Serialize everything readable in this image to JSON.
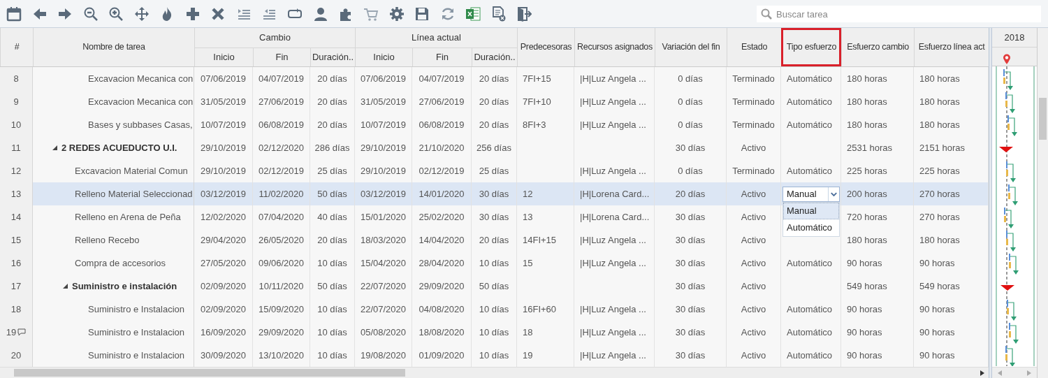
{
  "toolbar": {
    "search": {
      "placeholder": "Buscar tarea"
    }
  },
  "columns": [
    {
      "label": "#",
      "highlighted": false
    },
    {
      "label": "Nombre de tarea",
      "highlighted": false
    },
    {
      "label": "Cambio",
      "highlighted": false,
      "children": [
        {
          "label": "Inicio"
        },
        {
          "label": "Fin"
        },
        {
          "label": "Duración.."
        }
      ]
    },
    {
      "label": "Línea actual",
      "highlighted": false,
      "children": [
        {
          "label": "Inicio"
        },
        {
          "label": "Fin"
        },
        {
          "label": "Duración.."
        }
      ]
    },
    {
      "label": "Predecesoras",
      "highlighted": false
    },
    {
      "label": "Recursos asignados",
      "highlighted": false
    },
    {
      "label": "Variación del fin",
      "highlighted": false
    },
    {
      "label": "Estado",
      "highlighted": false
    },
    {
      "label": "Tipo esfuerzo",
      "highlighted": true
    },
    {
      "label": "Esfuerzo cambio",
      "highlighted": false
    },
    {
      "label": "Esfuerzo línea act",
      "highlighted": false
    }
  ],
  "gantt": {
    "year": "2018"
  },
  "rows": [
    {
      "number": "8",
      "name": "Excavacion Mecanica con",
      "selected": false,
      "has_comment": false,
      "cells": {
        "start_change": "07/06/2019",
        "end_change": "04/07/2019",
        "duration_change": "20 días",
        "start_baseline": "07/06/2019",
        "end_baseline": "04/07/2019",
        "duration_baseline": "20 días",
        "predecessors": "7FI+15",
        "resources": "|H|Luz Angela ...",
        "finish_variance": "0 días",
        "status": "Terminado",
        "effort_type": "Automático",
        "effort_change": "180 horas",
        "effort_baseline": "180 horas"
      }
    },
    {
      "number": "9",
      "name": "Excavacion Mecanica con",
      "selected": false,
      "has_comment": false,
      "cells": {
        "start_change": "31/05/2019",
        "end_change": "27/06/2019",
        "duration_change": "20 días",
        "start_baseline": "31/05/2019",
        "end_baseline": "27/06/2019",
        "duration_baseline": "20 días",
        "predecessors": "7FI+10",
        "resources": "|H|Luz Angela ...",
        "finish_variance": "0 días",
        "status": "Terminado",
        "effort_type": "Automático",
        "effort_change": "180 horas",
        "effort_baseline": "180 horas"
      }
    },
    {
      "number": "10",
      "name": "Bases y subbases Casas,",
      "selected": false,
      "has_comment": false,
      "cells": {
        "start_change": "10/07/2019",
        "end_change": "06/08/2019",
        "duration_change": "20 días",
        "start_baseline": "10/07/2019",
        "end_baseline": "06/08/2019",
        "duration_baseline": "20 días",
        "predecessors": "8FI+3",
        "resources": "|H|Luz Angela ...",
        "finish_variance": "0 días",
        "status": "Terminado",
        "effort_type": "Automático",
        "effort_change": "180 horas",
        "effort_baseline": "180 horas"
      }
    },
    {
      "number": "11",
      "name": "2 REDES ACUEDUCTO U.I.",
      "selected": false,
      "has_comment": false,
      "expanded": true,
      "cells": {
        "start_change": "29/10/2019",
        "end_change": "02/12/2020",
        "duration_change": "286 días",
        "start_baseline": "29/10/2019",
        "end_baseline": "21/10/2020",
        "duration_baseline": "256 días",
        "finish_variance": "30 días",
        "status": "Activo",
        "effort_change": "2531 horas",
        "effort_baseline": "2151 horas"
      },
      "children": [
        {
          "number": "12",
          "name": "Excavacion Material Comun",
          "selected": false,
          "has_comment": false,
          "cells": {
            "start_change": "29/10/2019",
            "end_change": "02/12/2019",
            "duration_change": "25 días",
            "start_baseline": "29/10/2019",
            "end_baseline": "02/12/2019",
            "duration_baseline": "25 días",
            "resources": "|H|Luz Angela ...",
            "finish_variance": "0 días",
            "status": "Terminado",
            "effort_type": "Automático",
            "effort_change": "225 horas",
            "effort_baseline": "225 horas"
          }
        },
        {
          "number": "13",
          "name": "Relleno Material Seleccionad",
          "selected": true,
          "has_comment": false,
          "cells": {
            "start_change": "03/12/2019",
            "end_change": "11/02/2020",
            "duration_change": "50 días",
            "start_baseline": "03/12/2019",
            "end_baseline": "14/01/2020",
            "duration_baseline": "30 días",
            "predecessors": "12",
            "resources": "|H|Lorena Card...",
            "finish_variance": "20 días",
            "status": "Activo",
            "effort_change": "200 horas",
            "effort_baseline": "270 horas"
          },
          "effort_type_editor": {
            "value": "Manual",
            "options": [
              {
                "label": "Manual",
                "selected": true
              },
              {
                "label": "Automático",
                "selected": false
              }
            ]
          }
        },
        {
          "number": "14",
          "name": "Relleno en Arena de Peña",
          "selected": false,
          "has_comment": false,
          "cells": {
            "start_change": "12/02/2020",
            "end_change": "07/04/2020",
            "duration_change": "40 días",
            "start_baseline": "15/01/2020",
            "end_baseline": "25/02/2020",
            "duration_baseline": "30 días",
            "predecessors": "13",
            "resources": "|H|Lorena Card...",
            "finish_variance": "30 días",
            "status": "Activo",
            "effort_change": "720 horas",
            "effort_baseline": "270 horas"
          }
        },
        {
          "number": "15",
          "name": "Relleno Recebo",
          "selected": false,
          "has_comment": false,
          "cells": {
            "start_change": "29/04/2020",
            "end_change": "26/05/2020",
            "duration_change": "20 días",
            "start_baseline": "18/03/2020",
            "end_baseline": "14/04/2020",
            "duration_baseline": "20 días",
            "predecessors": "14FI+15",
            "resources": "|H|Luz Angela ...",
            "finish_variance": "30 días",
            "status": "Activo",
            "effort_change": "180 horas",
            "effort_baseline": "180 horas"
          }
        },
        {
          "number": "16",
          "name": "Compra de accesorios",
          "selected": false,
          "has_comment": false,
          "cells": {
            "start_change": "27/05/2020",
            "end_change": "09/06/2020",
            "duration_change": "10 días",
            "start_baseline": "15/04/2020",
            "end_baseline": "28/04/2020",
            "duration_baseline": "10 días",
            "predecessors": "15",
            "resources": "|H|Luz Angela ...",
            "finish_variance": "30 días",
            "status": "Activo",
            "effort_type": "Automático",
            "effort_change": "90 horas",
            "effort_baseline": "90 horas"
          }
        },
        {
          "number": "17",
          "name": "Suministro e instalación",
          "selected": false,
          "has_comment": false,
          "expanded": true,
          "cells": {
            "start_change": "02/09/2020",
            "end_change": "10/11/2020",
            "duration_change": "50 días",
            "start_baseline": "22/07/2020",
            "end_baseline": "29/09/2020",
            "duration_baseline": "50 días",
            "finish_variance": "30 días",
            "status": "Activo",
            "effort_change": "549 horas",
            "effort_baseline": "549 horas"
          },
          "children": [
            {
              "number": "18",
              "name": "Suministro e Instalacion",
              "selected": false,
              "has_comment": false,
              "cells": {
                "start_change": "02/09/2020",
                "end_change": "15/09/2020",
                "duration_change": "10 días",
                "start_baseline": "22/07/2020",
                "end_baseline": "04/08/2020",
                "duration_baseline": "10 días",
                "predecessors": "16FI+60",
                "resources": "|H|Luz Angela ...",
                "finish_variance": "30 días",
                "status": "Activo",
                "effort_type": "Automático",
                "effort_change": "90 horas",
                "effort_baseline": "90 horas"
              }
            },
            {
              "number": "19",
              "name": "Suministro e Instalacion",
              "selected": false,
              "has_comment": true,
              "cells": {
                "start_change": "16/09/2020",
                "end_change": "29/09/2020",
                "duration_change": "10 días",
                "start_baseline": "05/08/2020",
                "end_baseline": "18/08/2020",
                "duration_baseline": "10 días",
                "predecessors": "18",
                "resources": "|H|Luz Angela ...",
                "finish_variance": "30 días",
                "status": "Activo",
                "effort_type": "Automático",
                "effort_change": "90 horas",
                "effort_baseline": "90 horas"
              }
            },
            {
              "number": "20",
              "name": "Suministro e Instalacion",
              "selected": false,
              "has_comment": false,
              "cells": {
                "start_change": "30/09/2020",
                "end_change": "13/10/2020",
                "duration_change": "10 días",
                "start_baseline": "19/08/2020",
                "end_baseline": "01/09/2020",
                "duration_baseline": "10 días",
                "predecessors": "19",
                "resources": "|H|Luz Angela ...",
                "finish_variance": "30 días",
                "status": "Activo",
                "effort_type": "Automático",
                "effort_change": "90 horas",
                "effort_baseline": "90 horas"
              }
            }
          ]
        }
      ]
    }
  ]
}
